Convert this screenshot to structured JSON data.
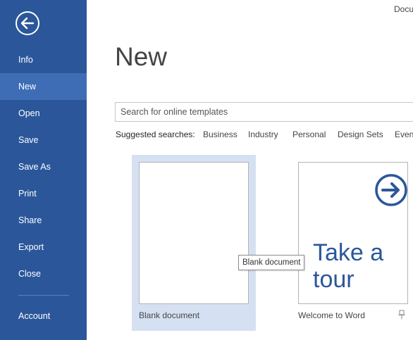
{
  "window": {
    "title": "Docu"
  },
  "sidebar": {
    "items": [
      {
        "label": "Info"
      },
      {
        "label": "New"
      },
      {
        "label": "Open"
      },
      {
        "label": "Save"
      },
      {
        "label": "Save As"
      },
      {
        "label": "Print"
      },
      {
        "label": "Share"
      },
      {
        "label": "Export"
      },
      {
        "label": "Close"
      },
      {
        "label": "Account"
      }
    ],
    "active": "New",
    "back_icon": "back-arrow-icon"
  },
  "main": {
    "title": "New",
    "search": {
      "placeholder": "Search for online templates",
      "value": ""
    },
    "suggested": {
      "label": "Suggested searches:",
      "links": [
        "Business",
        "Industry",
        "Personal",
        "Design Sets",
        "Event"
      ]
    },
    "templates": [
      {
        "label": "Blank document",
        "selected": true
      },
      {
        "label": "Welcome to Word",
        "thumb_text": "Take a tour",
        "icon": "arrow-circle-icon",
        "pin_icon": "pin-icon"
      }
    ],
    "tooltip": "Blank document"
  },
  "colors": {
    "sidebar_bg": "#2b579a",
    "sidebar_active": "#3e6db5",
    "selected_tile": "#d5e1f2",
    "accent": "#2b579a"
  }
}
